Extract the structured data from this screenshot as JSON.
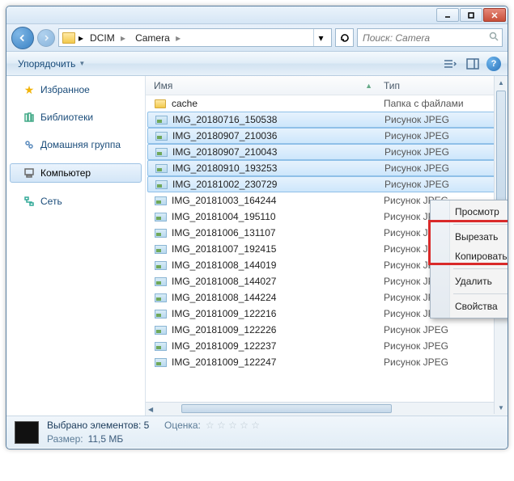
{
  "window": {
    "breadcrumb": [
      "DCIM",
      "Camera"
    ],
    "search_placeholder": "Поиск: Camera"
  },
  "toolbar": {
    "organize_label": "Упорядочить"
  },
  "sidebar": {
    "favorites": "Избранное",
    "libraries": "Библиотеки",
    "homegroup": "Домашняя группа",
    "computer": "Компьютер",
    "network": "Сеть"
  },
  "columns": {
    "name": "Имя",
    "type": "Тип"
  },
  "files": [
    {
      "name": "cache",
      "type": "Папка с файлами",
      "kind": "folder",
      "selected": false
    },
    {
      "name": "IMG_20180716_150538",
      "type": "Рисунок JPEG",
      "kind": "image",
      "selected": true
    },
    {
      "name": "IMG_20180907_210036",
      "type": "Рисунок JPEG",
      "kind": "image",
      "selected": true
    },
    {
      "name": "IMG_20180907_210043",
      "type": "Рисунок JPEG",
      "kind": "image",
      "selected": true
    },
    {
      "name": "IMG_20180910_193253",
      "type": "Рисунок JPEG",
      "kind": "image",
      "selected": true
    },
    {
      "name": "IMG_20181002_230729",
      "type": "Рисунок JPEG",
      "kind": "image",
      "selected": true
    },
    {
      "name": "IMG_20181003_164244",
      "type": "Рисунок JPEG",
      "kind": "image",
      "selected": false
    },
    {
      "name": "IMG_20181004_195110",
      "type": "Рисунок JPEG",
      "kind": "image",
      "selected": false
    },
    {
      "name": "IMG_20181006_131107",
      "type": "Рисунок JPEG",
      "kind": "image",
      "selected": false
    },
    {
      "name": "IMG_20181007_192415",
      "type": "Рисунок JPEG",
      "kind": "image",
      "selected": false
    },
    {
      "name": "IMG_20181008_144019",
      "type": "Рисунок JPEG",
      "kind": "image",
      "selected": false
    },
    {
      "name": "IMG_20181008_144027",
      "type": "Рисунок JPEG",
      "kind": "image",
      "selected": false
    },
    {
      "name": "IMG_20181008_144224",
      "type": "Рисунок JPEG",
      "kind": "image",
      "selected": false
    },
    {
      "name": "IMG_20181009_122216",
      "type": "Рисунок JPEG",
      "kind": "image",
      "selected": false
    },
    {
      "name": "IMG_20181009_122226",
      "type": "Рисунок JPEG",
      "kind": "image",
      "selected": false
    },
    {
      "name": "IMG_20181009_122237",
      "type": "Рисунок JPEG",
      "kind": "image",
      "selected": false
    },
    {
      "name": "IMG_20181009_122247",
      "type": "Рисунок JPEG",
      "kind": "image",
      "selected": false
    }
  ],
  "context_menu": {
    "view": "Просмотр",
    "cut": "Вырезать",
    "copy": "Копировать",
    "delete": "Удалить",
    "properties": "Свойства"
  },
  "status": {
    "selection_label": "Выбрано элементов: 5",
    "rating_label": "Оценка:",
    "size_label": "Размер:",
    "size_value": "11,5 МБ"
  }
}
